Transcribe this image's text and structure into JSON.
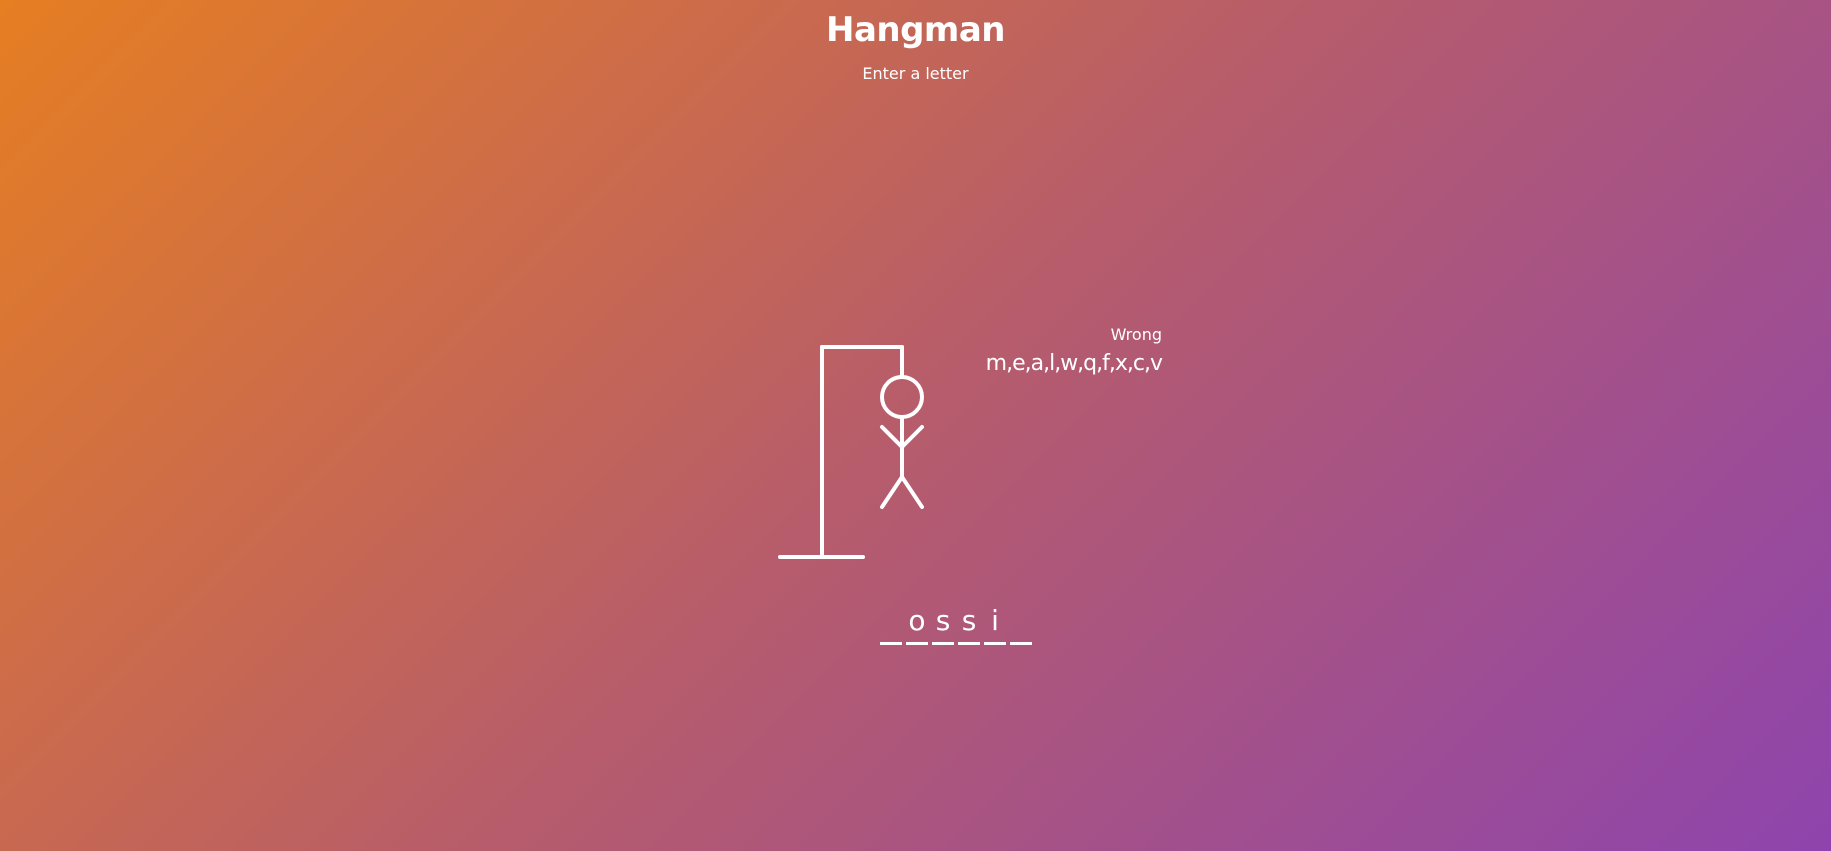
{
  "header": {
    "title": "Hangman",
    "subtitle": "Enter a letter"
  },
  "wrong": {
    "label": "Wrong",
    "letters": "m,e,a,l,w,q,f,x,c,v"
  },
  "word": {
    "slots": [
      "",
      "o",
      "s",
      "s",
      "i",
      ""
    ]
  },
  "figure": {
    "parts_shown": [
      "gallows",
      "head",
      "body",
      "left-arm",
      "right-arm",
      "left-leg",
      "right-leg"
    ]
  },
  "colors": {
    "gradient_start": "#e67e22",
    "gradient_end": "#8e44ad",
    "text": "#ffffff"
  }
}
